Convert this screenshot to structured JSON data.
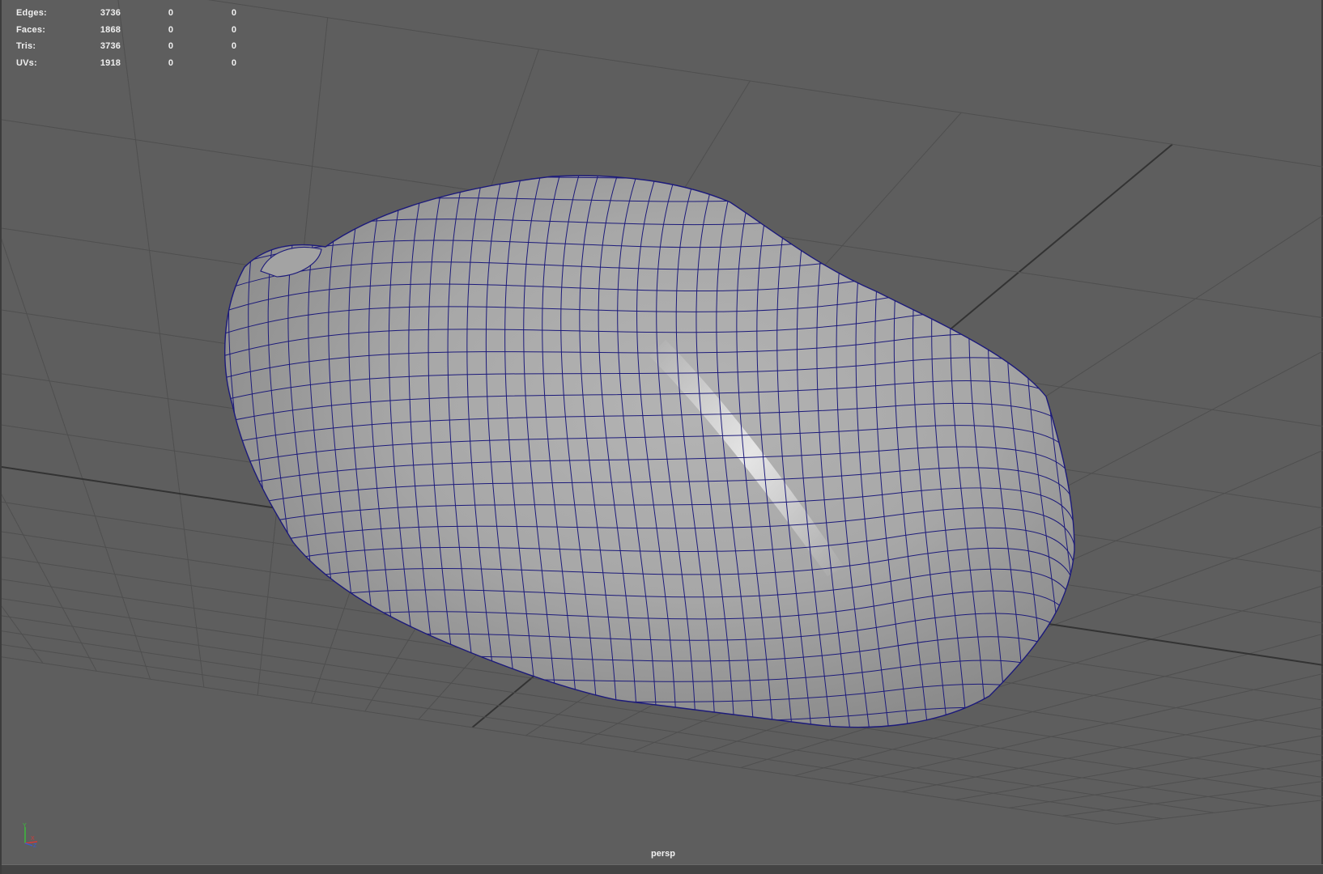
{
  "hud": {
    "rows": [
      {
        "label": "Edges:",
        "value": "3736",
        "col2": "0",
        "col3": "0"
      },
      {
        "label": "Faces:",
        "value": "1868",
        "col2": "0",
        "col3": "0"
      },
      {
        "label": "Tris:",
        "value": "3736",
        "col2": "0",
        "col3": "0"
      },
      {
        "label": "UVs:",
        "value": "1918",
        "col2": "0",
        "col3": "0"
      }
    ]
  },
  "viewport": {
    "camera": "persp"
  },
  "colors": {
    "background": "#5e5e5e",
    "grid": "#4f4f4f",
    "grid_axis": "#333333",
    "wireframe": "#1c1a7a",
    "mesh_shade": "#a9a9a9",
    "axis_x": "#d23a3a",
    "axis_y": "#3ac23a",
    "axis_z": "#3a5ad2"
  },
  "icons": {
    "axis_gizmo": "xyz-axis-icon"
  }
}
